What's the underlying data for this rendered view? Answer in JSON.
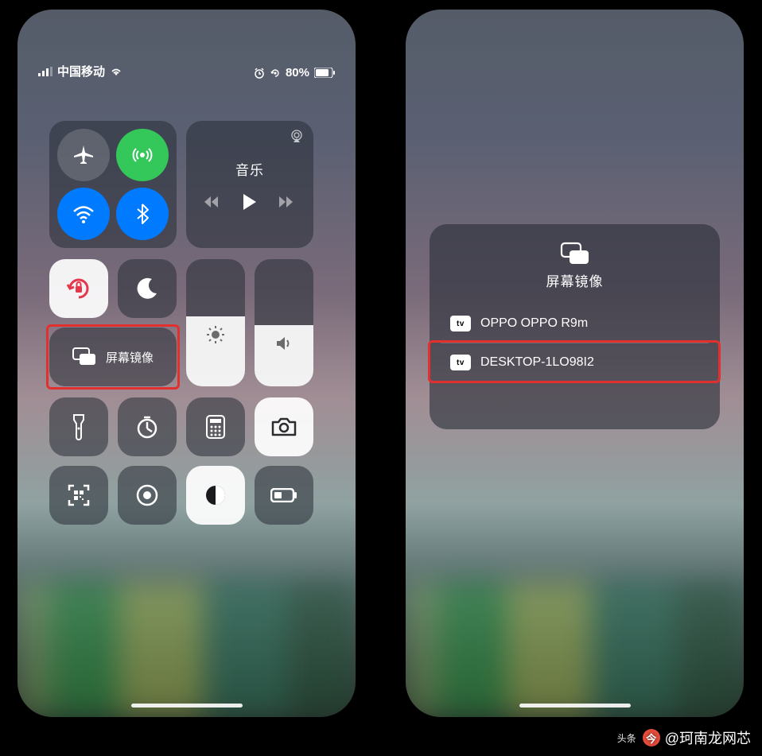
{
  "status": {
    "carrier": "中国移动",
    "battery_percent": "80%"
  },
  "media": {
    "title": "音乐"
  },
  "screen_mirror": {
    "label": "屏幕镜像",
    "panel_title": "屏幕镜像",
    "devices": [
      {
        "badge": "tv",
        "name": "OPPO OPPO R9m"
      },
      {
        "badge": "tv",
        "name": "DESKTOP-1LO98I2"
      }
    ]
  },
  "watermark": {
    "prefix": "头条",
    "author": "@珂南龙网芯"
  }
}
